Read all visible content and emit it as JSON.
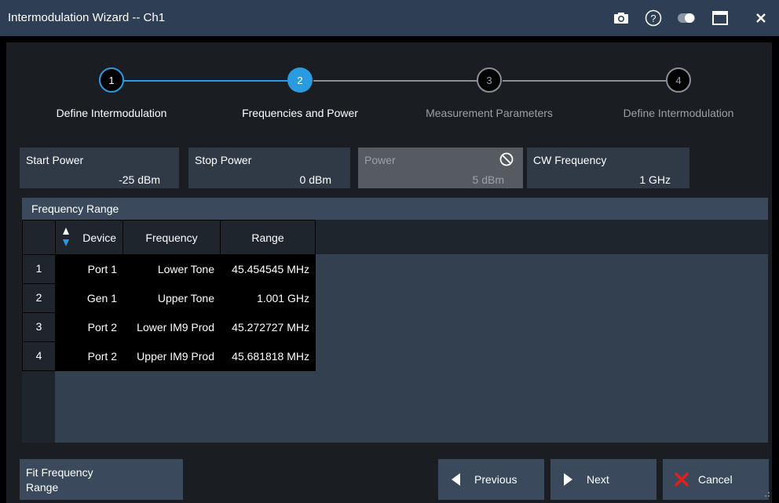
{
  "window": {
    "title": "Intermodulation Wizard -- Ch1"
  },
  "titlebar_icons": [
    "camera-icon",
    "help-icon",
    "toggle-icon",
    "maximize-icon",
    "close-icon"
  ],
  "steps": [
    {
      "number": "1",
      "label": "Define Intermodulation",
      "state": "done"
    },
    {
      "number": "2",
      "label": "Frequencies and Power",
      "state": "active"
    },
    {
      "number": "3",
      "label": "Measurement Parameters",
      "state": "pending"
    },
    {
      "number": "4",
      "label": "Define Intermodulation",
      "state": "pending"
    }
  ],
  "fields": {
    "start_power": {
      "label": "Start Power",
      "value": "-25 dBm"
    },
    "stop_power": {
      "label": "Stop Power",
      "value": "0 dBm"
    },
    "power": {
      "label": "Power",
      "value": "5 dBm",
      "disabled": true
    },
    "cw_frequency": {
      "label": "CW Frequency",
      "value": "1 GHz"
    }
  },
  "frequency_range": {
    "title": "Frequency Range",
    "columns": [
      "Device",
      "Frequency",
      "Range"
    ],
    "rows": [
      {
        "index": "1",
        "device": "Port 1",
        "frequency": "Lower Tone",
        "range": "45.454545 MHz"
      },
      {
        "index": "2",
        "device": "Gen 1",
        "frequency": "Upper Tone",
        "range": "1.001 GHz"
      },
      {
        "index": "3",
        "device": "Port 2",
        "frequency": "Lower IM9 Prod",
        "range": "45.272727 MHz"
      },
      {
        "index": "4",
        "device": "Port 2",
        "frequency": "Upper IM9 Prod",
        "range": "45.681818 MHz"
      }
    ]
  },
  "buttons": {
    "fit_frequency_range": "Fit Frequency Range",
    "previous": "Previous",
    "next": "Next",
    "cancel": "Cancel"
  },
  "colors": {
    "accent": "#2b9bdf",
    "cancel": "#e0201c",
    "titlebar": "#2e3f55"
  }
}
